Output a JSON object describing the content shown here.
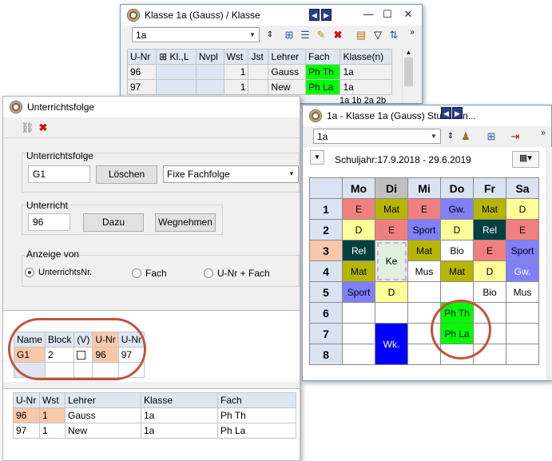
{
  "colors": {
    "green": "#00ff00",
    "blue": "#0000ff",
    "oval": "#c2523f",
    "pink": "#f08080",
    "olive": "#b6b600",
    "purple": "#8080ff",
    "yellow": "#ffff99",
    "darkgreen": "#004040",
    "peach": "#f8c8a8"
  },
  "klasse_window": {
    "title": "Klasse 1a (Gauss) / Klasse",
    "combo_value": "1a",
    "columns": [
      "U-Nr",
      "Kl.,L",
      "Nvpl",
      "Wst",
      "Jst",
      "Lehrer",
      "Fach",
      "Klasse(n)"
    ],
    "rows": [
      {
        "unr": "96",
        "wst": "1",
        "lehrer": "Gauss",
        "fach": "Ph Th",
        "klassen": "1a"
      },
      {
        "unr": "97",
        "wst": "1",
        "lehrer": "New",
        "fach": "Ph La",
        "klassen": "1a"
      }
    ],
    "partial_row": "1a 1b 2a 2b"
  },
  "uf_window": {
    "title": "Unterrichtsfolge",
    "group1_label": "Unterrichtsfolge",
    "uf_value": "G1",
    "loeschen": "Löschen",
    "fachfolge": "Fixe Fachfolge",
    "group2_label": "Unterricht",
    "unterricht_value": "96",
    "dazu": "Dazu",
    "wegnehmen": "Wegnehmen",
    "group3_label": "Anzeige von",
    "radios": [
      "UnterrichtsNr.",
      "Fach",
      "U-Nr + Fach"
    ],
    "folge_table": {
      "columns": [
        "Name",
        "Block",
        "(V)",
        "U-Nr",
        "U-Nr"
      ],
      "row": {
        "name": "G1",
        "block": "2",
        "unr1": "96",
        "unr2": "97"
      }
    },
    "detail_table": {
      "columns": [
        "U-Nr",
        "Wst",
        "Lehrer",
        "Klasse",
        "Fach"
      ],
      "rows": [
        {
          "unr": "96",
          "wst": "1",
          "lehrer": "Gauss",
          "klasse": "1a",
          "fach": "Ph Th"
        },
        {
          "unr": "97",
          "wst": "1",
          "lehrer": "New",
          "klasse": "1a",
          "fach": "Ph La"
        }
      ]
    }
  },
  "plan_window": {
    "title": "1a - Klasse 1a (Gauss)  Stun...lan...",
    "combo_value": "1a",
    "schuljahr": "Schuljahr:17.9.2018 - 29.6.2019",
    "days": [
      "Mo",
      "Di",
      "Mi",
      "Do",
      "Fr",
      "Sa"
    ],
    "hours": [
      "1",
      "2",
      "3",
      "4",
      "5",
      "6",
      "7",
      "8"
    ],
    "cells": [
      [
        "E",
        "Mat",
        "E",
        "Gw.",
        "Mat",
        "D"
      ],
      [
        "D",
        "E",
        "Sport",
        "D",
        "Rel",
        "E"
      ],
      [
        "Rel",
        "Ke",
        "Mat",
        "Bio",
        "E",
        "Sport"
      ],
      [
        "Mat",
        "",
        "Mus",
        "Mat",
        "D",
        "Gw."
      ],
      [
        "Sport",
        "D",
        "",
        "",
        "Bio",
        "Mus"
      ],
      [
        "",
        "",
        "",
        "Ph Th",
        "",
        ""
      ],
      [
        "",
        "Wk.",
        "",
        "Ph La",
        "",
        ""
      ],
      [
        "",
        "",
        "",
        "",
        "",
        ""
      ]
    ]
  }
}
